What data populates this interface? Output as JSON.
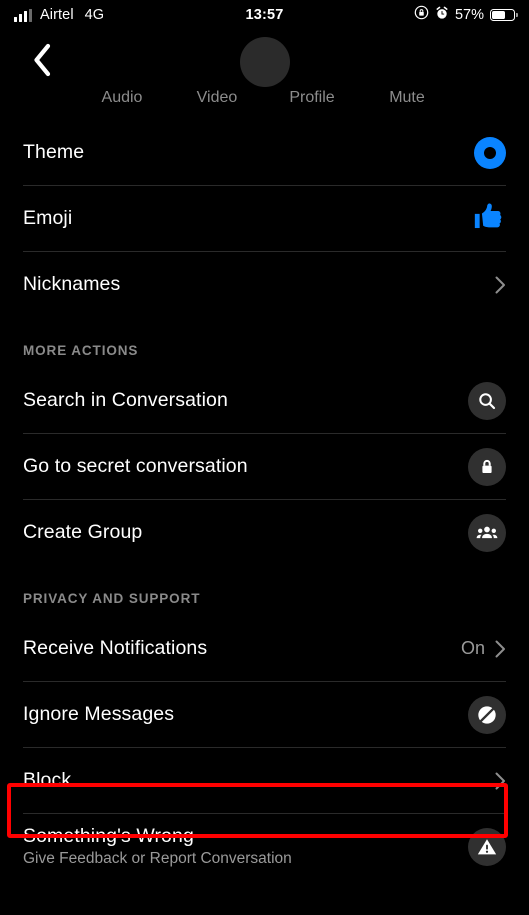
{
  "statusbar": {
    "carrier": "Airtel",
    "network": "4G",
    "time": "13:57",
    "battery_percent": "57%",
    "signal_icon": "signal-bars-icon",
    "rotation_lock_icon": "rotation-lock-icon",
    "alarm_icon": "alarm-clock-icon",
    "battery_icon": "battery-icon"
  },
  "header": {
    "back_icon": "back-chevron-icon",
    "avatar": "contact-avatar",
    "tabs": [
      {
        "label": "Audio",
        "name": "tab-audio"
      },
      {
        "label": "Video",
        "name": "tab-video"
      },
      {
        "label": "Profile",
        "name": "tab-profile"
      },
      {
        "label": "Mute",
        "name": "tab-mute"
      }
    ]
  },
  "sections": [
    {
      "header": "",
      "rows": [
        {
          "label": "Theme",
          "accessory": "theme-color-dot"
        },
        {
          "label": "Emoji",
          "accessory": "thumbs-up-icon"
        },
        {
          "label": "Nicknames",
          "accessory": "chevron-right-icon"
        }
      ]
    },
    {
      "header": "MORE ACTIONS",
      "rows": [
        {
          "label": "Search in Conversation",
          "accessory": "search-icon"
        },
        {
          "label": "Go to secret conversation",
          "accessory": "lock-icon"
        },
        {
          "label": "Create Group",
          "accessory": "people-group-icon"
        }
      ]
    },
    {
      "header": "PRIVACY AND SUPPORT",
      "rows": [
        {
          "label": "Receive Notifications",
          "value": "On",
          "accessory": "chevron-right-icon"
        },
        {
          "label": "Ignore Messages",
          "accessory": "ignore-slash-icon"
        },
        {
          "label": "Block",
          "accessory": "chevron-right-icon",
          "highlighted": true
        },
        {
          "label": "Something's Wrong",
          "sublabel": "Give Feedback or Report Conversation",
          "accessory": "warning-triangle-icon"
        }
      ]
    }
  ],
  "colors": {
    "background": "#000000",
    "accent_blue": "#0a84ff",
    "highlight_red": "#ff0000",
    "badge_gray": "#303030",
    "divider": "#2a2a2a",
    "muted_text": "#9a9a9a"
  }
}
